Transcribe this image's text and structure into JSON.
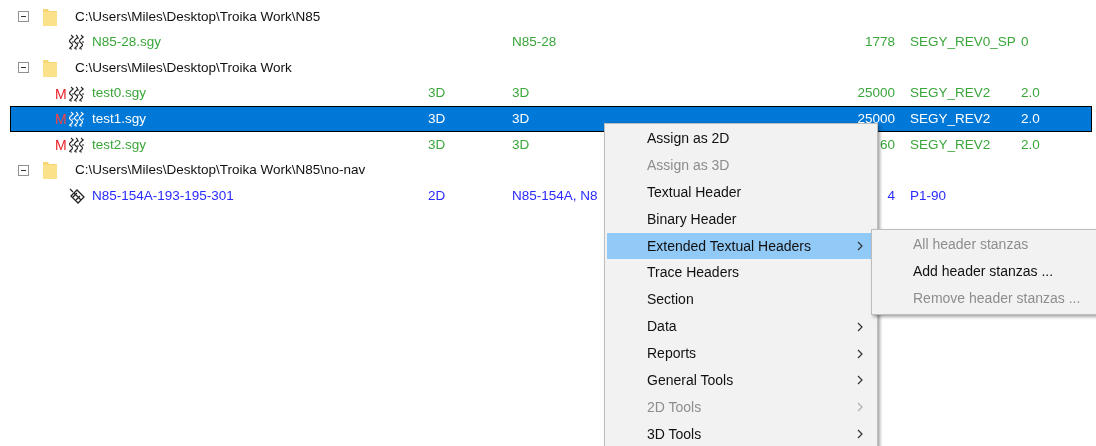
{
  "tree": [
    {
      "path": "C:\\Users\\Miles\\Desktop\\Troika Work\\N85",
      "expanded": true,
      "children": [
        {
          "kind": "seismic",
          "name": "N85-28.sgy",
          "color": "#3aa63a",
          "selected": false,
          "column_3": "N85-28",
          "column_4": "1778",
          "column_5": "SEGY_REV0_SP",
          "column_6": "0"
        }
      ]
    },
    {
      "path": "C:\\Users\\Miles\\Desktop\\Troika Work",
      "expanded": true,
      "children": [
        {
          "kind": "seismic",
          "marker": "M",
          "name": "test0.sgy",
          "color": "#3aa63a",
          "selected": false,
          "column_2": "3D",
          "column_3": "3D",
          "column_4": "25000",
          "column_5": "SEGY_REV2",
          "column_6": "2.0"
        },
        {
          "kind": "seismic",
          "marker": "M",
          "name": "test1.sgy",
          "selected": true,
          "column_2": "3D",
          "column_3": "3D",
          "column_4": "25000",
          "column_5": "SEGY_REV2",
          "column_6": "2.0"
        },
        {
          "kind": "seismic",
          "marker": "M",
          "name": "test2.sgy",
          "color": "#3aa63a",
          "selected": false,
          "column_2": "3D",
          "column_3": "3D",
          "column_4": "60",
          "column_5": "SEGY_REV2",
          "column_6": "2.0"
        }
      ]
    },
    {
      "path": "C:\\Users\\Miles\\Desktop\\Troika Work\\N85\\no-nav",
      "expanded": true,
      "children": [
        {
          "kind": "navless",
          "name": "N85-154A-193-195-301",
          "color": "#2a2aff",
          "selected": false,
          "column_2": "2D",
          "column_3": "N85-154A, N8",
          "column_4": "4",
          "column_5": "P1-90"
        }
      ]
    }
  ],
  "context_menu": {
    "items": [
      {
        "label": "Assign as 2D",
        "disabled": false,
        "submenu": false,
        "selected": false
      },
      {
        "label": "Assign as 3D",
        "disabled": true,
        "submenu": false,
        "selected": false
      },
      {
        "label": "Textual Header",
        "disabled": false,
        "submenu": false,
        "selected": false
      },
      {
        "label": "Binary Header",
        "disabled": false,
        "submenu": false,
        "selected": false
      },
      {
        "label": "Extended Textual Headers",
        "disabled": false,
        "submenu": true,
        "selected": true
      },
      {
        "label": "Trace Headers",
        "disabled": false,
        "submenu": false,
        "selected": false
      },
      {
        "label": "Section",
        "disabled": false,
        "submenu": false,
        "selected": false
      },
      {
        "label": "Data",
        "disabled": false,
        "submenu": true,
        "selected": false
      },
      {
        "label": "Reports",
        "disabled": false,
        "submenu": true,
        "selected": false
      },
      {
        "label": "General Tools",
        "disabled": false,
        "submenu": true,
        "selected": false
      },
      {
        "label": "2D Tools",
        "disabled": true,
        "submenu": true,
        "selected": false
      },
      {
        "label": "3D Tools",
        "disabled": false,
        "submenu": true,
        "selected": false
      }
    ]
  },
  "submenu": {
    "items": [
      {
        "label": "All header stanzas",
        "disabled": true
      },
      {
        "label": "Add header stanzas ...",
        "disabled": false
      },
      {
        "label": "Remove header stanzas ...",
        "disabled": true
      }
    ]
  }
}
